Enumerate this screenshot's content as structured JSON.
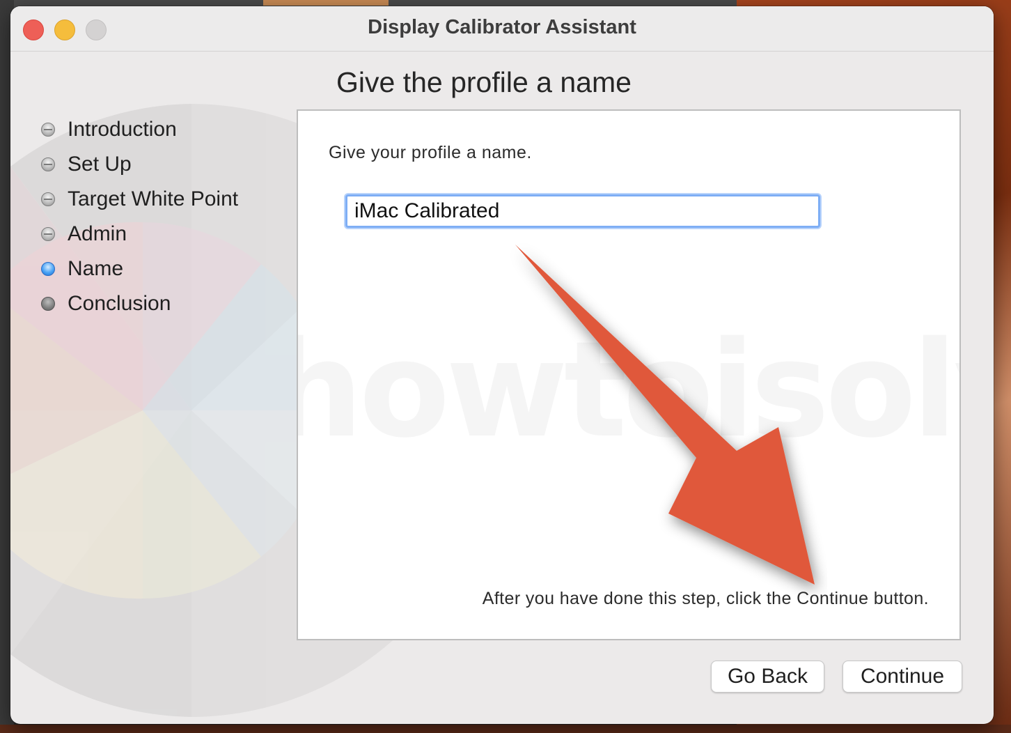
{
  "window": {
    "title": "Display Calibrator Assistant"
  },
  "page": {
    "heading": "Give the profile a name"
  },
  "steps": [
    {
      "label": "Introduction",
      "state": "done"
    },
    {
      "label": "Set Up",
      "state": "done"
    },
    {
      "label": "Target White Point",
      "state": "done"
    },
    {
      "label": "Admin",
      "state": "done"
    },
    {
      "label": "Name",
      "state": "current"
    },
    {
      "label": "Conclusion",
      "state": "pending"
    }
  ],
  "content": {
    "prompt": "Give your profile a name.",
    "profile_name_value": "iMac Calibrated",
    "hint": "After you have done this step, click the Continue button."
  },
  "buttons": {
    "go_back": "Go Back",
    "continue": "Continue"
  },
  "watermark": "(c) howtoisolve.com",
  "colors": {
    "annotation_arrow": "#e0583a",
    "focus_ring": "#7eaef5",
    "current_step": "#4aa3f5"
  }
}
